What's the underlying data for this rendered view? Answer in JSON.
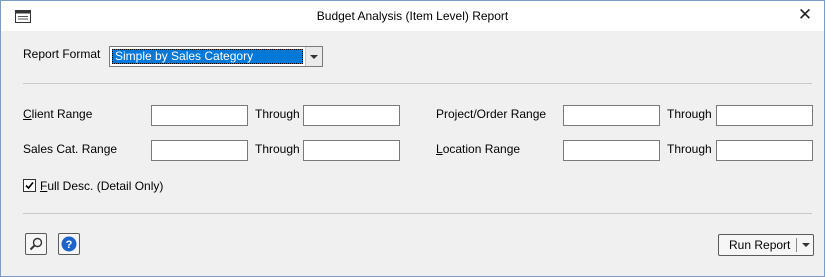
{
  "window": {
    "title": "Budget Analysis (Item Level) Report",
    "close_glyph": "✕"
  },
  "report_format": {
    "label": "Report Format",
    "selected": "Simple by Sales Category"
  },
  "client_range": {
    "label_first": "C",
    "label_rest": "lient Range",
    "through_label": "Through",
    "from_value": "",
    "to_value": ""
  },
  "sales_cat_range": {
    "label": "Sales Cat. Range",
    "through_label": "Through",
    "from_value": "",
    "to_value": ""
  },
  "project_order_range": {
    "label": "Project/Order Range",
    "through_label": "Through",
    "from_value": "",
    "to_value": ""
  },
  "location_range": {
    "label_first": "L",
    "label_rest": "ocation Range",
    "through_label": "Through",
    "from_value": "",
    "to_value": ""
  },
  "full_desc": {
    "label_first": "F",
    "label_rest": "ull Desc. (Detail Only)",
    "checked": true
  },
  "footer": {
    "search_icon": "magnifier-icon",
    "help_icon": "help-icon",
    "run_label": "Run Report"
  },
  "colors": {
    "selection": "#0078d7",
    "help_blue": "#1e64c8",
    "window_border": "#7a9cc6"
  }
}
